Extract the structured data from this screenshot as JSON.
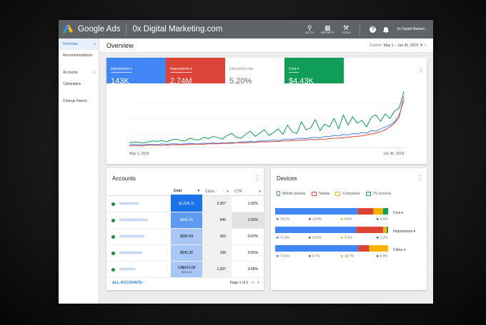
{
  "header": {
    "product": "Google Ads",
    "account_name": "0x Digital Marketing.com",
    "tools": [
      {
        "icon": "search-icon",
        "label": "GO TO"
      },
      {
        "icon": "reports-icon",
        "label": "REPORTS"
      },
      {
        "icon": "wrench-icon",
        "label": "TOOLS"
      }
    ],
    "customer": "0x Digital Marketi..."
  },
  "sidebar": {
    "items": [
      {
        "label": "Overview",
        "active": true
      },
      {
        "label": "Recommendations"
      },
      {
        "label": "Accounts"
      },
      {
        "label": "Campaigns"
      },
      {
        "label": "Change history"
      }
    ]
  },
  "overview": {
    "title": "Overview",
    "range_label": "Custom",
    "range_value": "May 1 – Jun 30, 2019"
  },
  "metrics": [
    {
      "label": "Interactions",
      "value": "143K",
      "color": "#4285f4"
    },
    {
      "label": "Impressions",
      "value": "2.74M",
      "color": "#db4437"
    },
    {
      "label": "Interaction rate",
      "value": "5.20%",
      "color": "#ffffff"
    },
    {
      "label": "Cost",
      "value": "$4.43K",
      "color": "#0f9d58"
    }
  ],
  "chart_data": [
    {
      "type": "line",
      "x_labels": [
        "May 1, 2019",
        "Jun 30, 2019"
      ],
      "series": [
        {
          "color": "#0f9d58",
          "values": [
            10,
            12,
            11,
            10,
            12,
            14,
            13,
            15,
            12,
            16,
            18,
            15,
            14,
            20,
            17,
            16,
            22,
            19,
            24,
            21,
            18,
            26,
            30,
            22,
            20,
            28,
            35,
            24,
            30,
            38,
            26,
            32,
            40,
            28,
            48,
            34,
            30,
            55,
            38,
            42,
            60,
            36,
            50,
            44,
            62,
            40,
            70,
            48,
            66,
            52,
            58,
            44,
            64,
            70,
            56,
            72,
            62,
            78,
            84,
            120
          ]
        },
        {
          "color": "#4285f4",
          "values": [
            6,
            7,
            6,
            6,
            7,
            7,
            6,
            8,
            7,
            8,
            8,
            7,
            8,
            9,
            8,
            8,
            9,
            9,
            10,
            9,
            10,
            10,
            11,
            10,
            12,
            12,
            13,
            12,
            14,
            14,
            15,
            16,
            15,
            17,
            18,
            17,
            19,
            20,
            19,
            21,
            22,
            21,
            24,
            23,
            26,
            25,
            28,
            27,
            30,
            29,
            32,
            31,
            36,
            35,
            40,
            44,
            48,
            55,
            70,
            100
          ]
        },
        {
          "color": "#db4437",
          "values": [
            4,
            4,
            4,
            4,
            5,
            5,
            5,
            5,
            5,
            6,
            6,
            6,
            6,
            7,
            7,
            7,
            7,
            8,
            8,
            8,
            9,
            9,
            9,
            10,
            10,
            10,
            11,
            11,
            12,
            12,
            12,
            13,
            13,
            14,
            14,
            15,
            15,
            16,
            16,
            17,
            17,
            18,
            18,
            19,
            20,
            20,
            21,
            22,
            23,
            24,
            25,
            27,
            29,
            31,
            34,
            38,
            44,
            52,
            65,
            110
          ]
        }
      ]
    },
    {
      "type": "bar",
      "stacked": true,
      "categories": [
        "Cost",
        "Impressions",
        "Clicks"
      ],
      "series": [
        {
          "name": "Mobile phones",
          "color": "#4285f4",
          "values": [
            73.2,
            71.9,
            73.6
          ],
          "labels": [
            "73.2%",
            "71.9%",
            "73.6%"
          ]
        },
        {
          "name": "Tablets",
          "color": "#db4437",
          "values": [
            13.8,
            23.8,
            9.7
          ],
          "labels": [
            "13.8%",
            "23.8%",
            "9.7%"
          ]
        },
        {
          "name": "Computers",
          "color": "#f4b400",
          "values": [
            8.5,
            3.1,
            16.7
          ],
          "labels": [
            "8.5%",
            "3.1%",
            "16.7%"
          ]
        },
        {
          "name": "TV screens",
          "color": "#0f9d58",
          "values": [
            4.6,
            1.2,
            0.0
          ],
          "labels": [
            "4.6%",
            "1.2%",
            "0.0%"
          ]
        }
      ]
    }
  ],
  "accounts": {
    "title": "Accounts",
    "columns": [
      "Cost",
      "Clicks",
      "CTR"
    ],
    "rows": [
      {
        "cost": "$1,636.11",
        "clicks": "2,257",
        "ctr": "1.02%"
      },
      {
        "cost": "$840.20",
        "clicks": "545",
        "ctr": "2.91%"
      },
      {
        "cost": "$556.59",
        "clicks": "262",
        "ctr": "0.07%"
      },
      {
        "cost": "$542.30",
        "clicks": "199",
        "ctr": "0.01%"
      },
      {
        "cost": "CA$610.05",
        "cost_sub": "$456.35",
        "clicks": "1,337",
        "ctr": "0.55%"
      }
    ],
    "all_link": "ALL ACCOUNTS",
    "pager": "Page 1 of 2"
  },
  "devices": {
    "title": "Devices"
  }
}
